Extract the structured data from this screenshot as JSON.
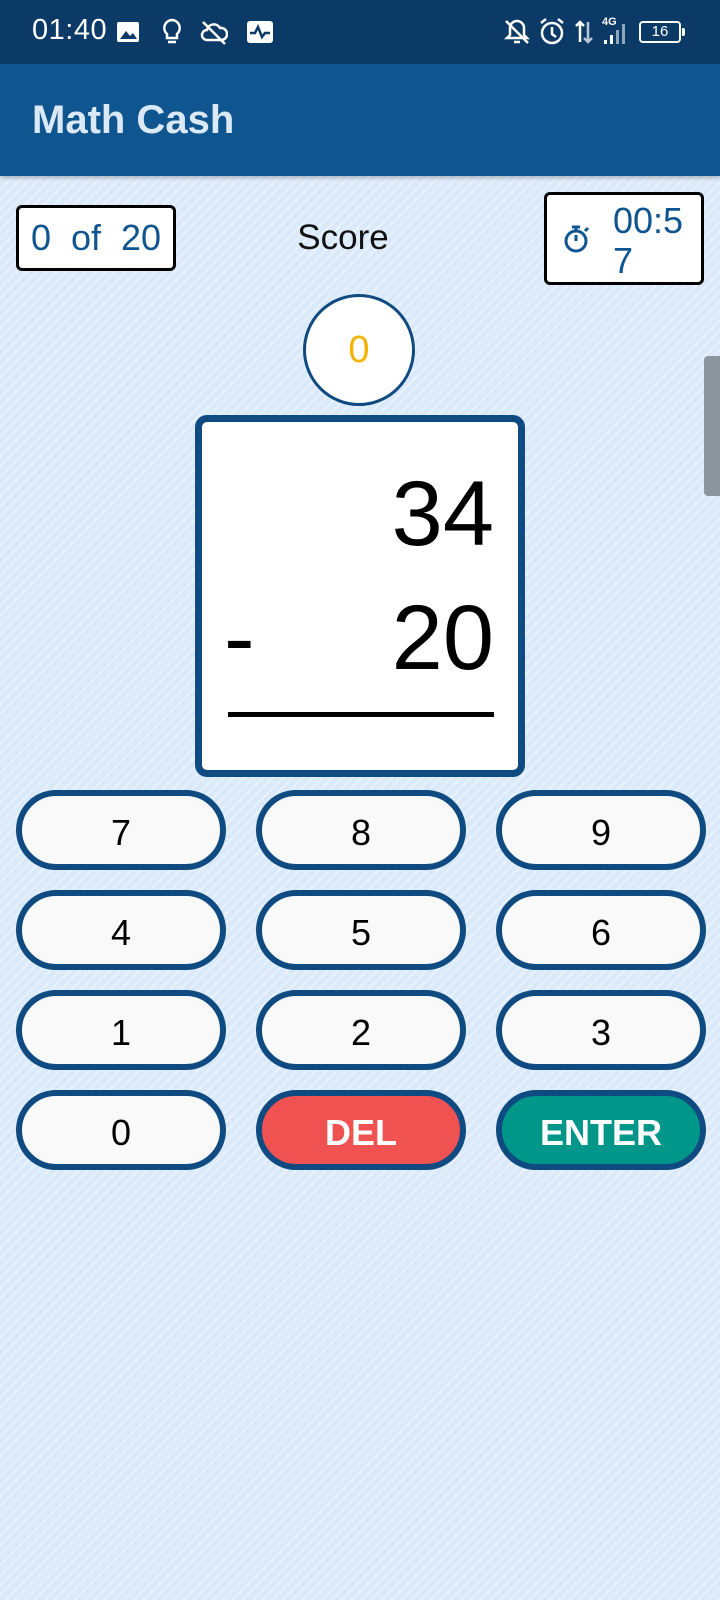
{
  "status_bar": {
    "time": "01:40",
    "network": "4G",
    "battery": "16",
    "icons": [
      "image-icon",
      "lightbulb-icon",
      "cloud-off-icon",
      "activity-icon",
      "notifications-off-icon",
      "alarm-icon",
      "data-arrows-icon",
      "signal-icon",
      "battery-icon"
    ]
  },
  "app_bar": {
    "title": "Math Cash"
  },
  "quiz": {
    "progress": "0  of  20",
    "score_label": "Score",
    "score": "0",
    "timer": "00:57",
    "timer_icon": "stopwatch-icon"
  },
  "problem": {
    "operand_top": "34",
    "operator": "-",
    "operand_bottom": "20"
  },
  "keypad": {
    "rows": [
      [
        "7",
        "8",
        "9"
      ],
      [
        "4",
        "5",
        "6"
      ],
      [
        "1",
        "2",
        "3"
      ],
      [
        "0",
        "DEL",
        "ENTER"
      ]
    ]
  },
  "colors": {
    "status_bar": "#0c3a66",
    "app_bar": "#0f5590",
    "background": "#dbeafa",
    "accent_blue": "#0f4a80",
    "score": "#f5b301",
    "delete": "#f05252",
    "enter": "#00968a"
  }
}
